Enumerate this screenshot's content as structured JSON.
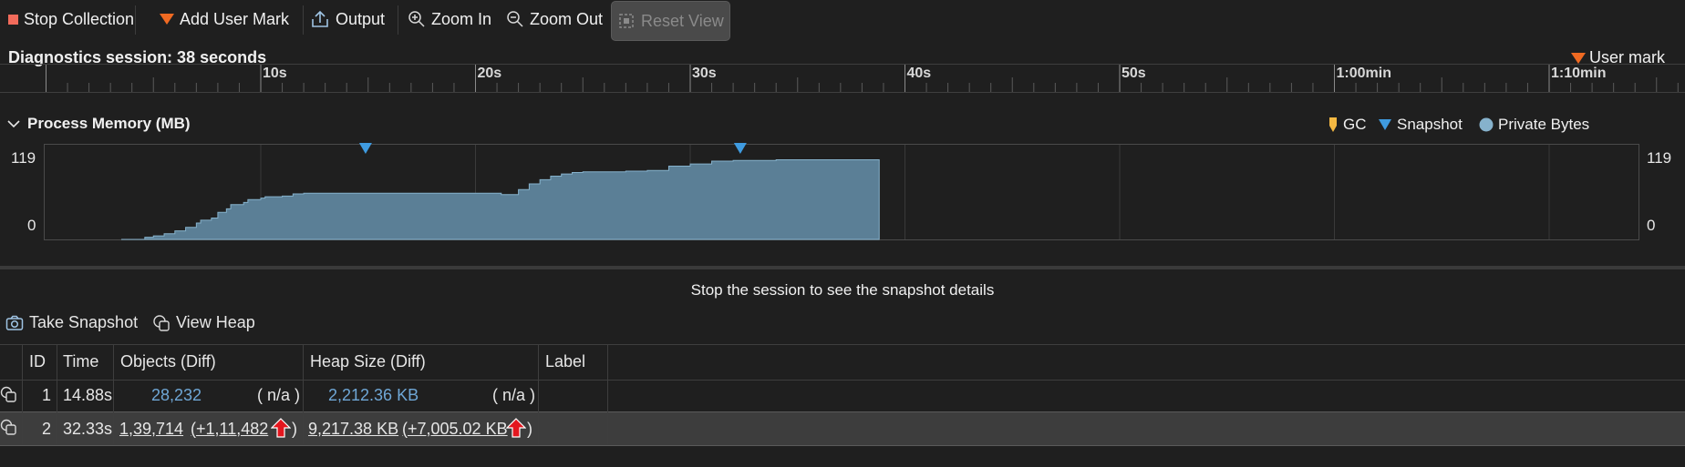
{
  "toolbar": {
    "stop": "Stop Collection",
    "add_mark": "Add User Mark",
    "output": "Output",
    "zoom_in": "Zoom In",
    "zoom_out": "Zoom Out",
    "reset_view": "Reset View"
  },
  "session": {
    "title": "Diagnostics session: 38 seconds",
    "user_mark": "User mark"
  },
  "ruler": {
    "ticks": [
      "10s",
      "20s",
      "30s",
      "40s",
      "50s",
      "1:00min",
      "1:10min"
    ]
  },
  "memory": {
    "title": "Process Memory (MB)",
    "legend": {
      "gc": "GC",
      "snapshot": "Snapshot",
      "private_bytes": "Private Bytes"
    },
    "y_max": "119",
    "y_min": "0"
  },
  "colors": {
    "area_fill": "#5b7f96",
    "area_stroke": "#86b2cc",
    "snapshot_marker": "#3f9be0",
    "gc_marker": "#f5b942",
    "user_mark": "#f06a22",
    "stop": "#f26b5b",
    "arrow_red": "#e4161e"
  },
  "chart_data": {
    "type": "area",
    "xlabel": "",
    "ylabel": "",
    "x_unit": "seconds",
    "xlim": [
      0,
      74
    ],
    "ylim": [
      0,
      119
    ],
    "series": [
      {
        "values_x": [
          3.5,
          4.5,
          4.6,
          5.0,
          5.5,
          6.0,
          6.5,
          7.0,
          7.2,
          7.7,
          8.0,
          8.4,
          8.6,
          9.2,
          9.4,
          10.0,
          10.2,
          11.0,
          11.5,
          12.0,
          12.5,
          13.5,
          14.0,
          16.0,
          18.0,
          20.0,
          21.0,
          21.2,
          22.0,
          22.5,
          23.0,
          23.5,
          24.0,
          24.5,
          25.0,
          26.0,
          27.0,
          28.0,
          29.0,
          30.0,
          31.0,
          32.0,
          33.0,
          34.0,
          35.0,
          36.0,
          37.0,
          38.0,
          38.8
        ],
        "values_y": [
          0,
          0,
          3,
          5,
          8,
          12,
          17,
          23,
          27,
          30,
          38,
          43,
          49,
          52,
          56,
          58,
          60,
          61,
          64,
          65,
          65,
          65,
          65,
          65,
          65,
          65,
          65,
          63,
          70,
          78,
          84,
          89,
          92,
          94,
          95,
          95,
          96,
          97,
          103,
          106,
          110,
          111,
          111,
          112,
          112,
          112,
          112,
          112,
          112
        ]
      }
    ],
    "snapshot_marks_x": [
      14.88,
      32.33
    ]
  },
  "snapshot_panel": {
    "message": "Stop the session to see the snapshot details",
    "take_snapshot": "Take Snapshot",
    "view_heap": "View Heap"
  },
  "table": {
    "headers": [
      "ID",
      "Time",
      "Objects (Diff)",
      "Heap Size (Diff)",
      "Label"
    ],
    "rows": [
      {
        "id": "1",
        "time": "14.88s",
        "objects": "28,232",
        "objects_diff": "( n/a )",
        "heap": "2,212.36 KB",
        "heap_diff": "( n/a )",
        "label": ""
      },
      {
        "id": "2",
        "time": "32.33s",
        "objects": "1,39,714",
        "objects_diff": "(+1,11,482",
        "heap": "9,217.38 KB",
        "heap_diff": "(+7,005.02 KB",
        "close": ")",
        "label": ""
      }
    ]
  }
}
